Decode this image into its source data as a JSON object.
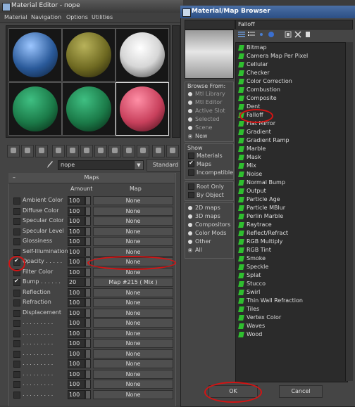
{
  "material_editor": {
    "title": "Material Editor - поре",
    "menu": [
      "Material",
      "Navigation",
      "Options",
      "Utilities"
    ],
    "slots": [
      {
        "color": "#4a7fc0"
      },
      {
        "color": "#8f8a32"
      },
      {
        "color": "#f2f2f2"
      },
      {
        "color": "#1f8a55"
      },
      {
        "color": "#1f8a55"
      },
      {
        "color": "#d64a6a"
      }
    ],
    "material_name": "поре",
    "material_type": "Standard",
    "maps_rollout": {
      "title": "Maps",
      "collapse_symbol": "–",
      "columns": {
        "amount": "Amount",
        "map": "Map"
      },
      "rows": [
        {
          "label": "Ambient Color",
          "amount": "100",
          "map": "None",
          "checked": false
        },
        {
          "label": "Diffuse Color",
          "amount": "100",
          "map": "None",
          "checked": false
        },
        {
          "label": "Specular Color",
          "amount": "100",
          "map": "None",
          "checked": false
        },
        {
          "label": "Specular Level",
          "amount": "100",
          "map": "None",
          "checked": false
        },
        {
          "label": "Glossiness",
          "amount": "100",
          "map": "None",
          "checked": false
        },
        {
          "label": "Self-Illumination",
          "amount": "100",
          "map": "None",
          "checked": false
        },
        {
          "label": "Opacity . . . . .",
          "amount": "100",
          "map": "None",
          "checked": true
        },
        {
          "label": "Filter Color",
          "amount": "100",
          "map": "None",
          "checked": false
        },
        {
          "label": "Bump . . . . . .",
          "amount": "20",
          "map": "Map #215  ( Mix )",
          "checked": true
        },
        {
          "label": "Reflection",
          "amount": "100",
          "map": "None",
          "checked": false
        },
        {
          "label": "Refraction",
          "amount": "100",
          "map": "None",
          "checked": false
        },
        {
          "label": "Displacement",
          "amount": "100",
          "map": "None",
          "checked": false
        },
        {
          "label": ". . . . . . . . .",
          "amount": "100",
          "map": "None",
          "checked": false
        },
        {
          "label": ". . . . . . . . .",
          "amount": "100",
          "map": "None",
          "checked": false
        },
        {
          "label": ". . . . . . . . .",
          "amount": "100",
          "map": "None",
          "checked": false
        },
        {
          "label": ". . . . . . . . .",
          "amount": "100",
          "map": "None",
          "checked": false
        },
        {
          "label": ". . . . . . . . .",
          "amount": "100",
          "map": "None",
          "checked": false
        },
        {
          "label": ". . . . . . . . .",
          "amount": "100",
          "map": "None",
          "checked": false
        },
        {
          "label": ". . . . . . . . .",
          "amount": "100",
          "map": "None",
          "checked": false
        },
        {
          "label": ". . . . . . . . .",
          "amount": "100",
          "map": "None",
          "checked": false
        }
      ]
    }
  },
  "browser": {
    "title": "Material/Map Browser",
    "filter_text": "Falloff",
    "browse_from": {
      "title": "Browse From:",
      "options": [
        "Mtl Library",
        "Mtl Editor",
        "Active Slot",
        "Selected",
        "Scene",
        "New"
      ],
      "selected": "New"
    },
    "show": {
      "title": "Show",
      "options": [
        {
          "label": "Materials",
          "checked": false
        },
        {
          "label": "Maps",
          "checked": true
        },
        {
          "label": "Incompatible",
          "checked": false
        }
      ]
    },
    "root": [
      {
        "label": "Root Only",
        "checked": false
      },
      {
        "label": "By Object",
        "checked": false
      }
    ],
    "map_types": {
      "options": [
        "2D maps",
        "3D maps",
        "Compositors",
        "Color Mods",
        "Other",
        "All"
      ],
      "selected": "All"
    },
    "items": [
      "Bitmap",
      "Camera Map Per Pixel",
      "Cellular",
      "Checker",
      "Color Correction",
      "Combustion",
      "Composite",
      "Dent",
      "Falloff",
      "Flat Mirror",
      "Gradient",
      "Gradient Ramp",
      "Marble",
      "Mask",
      "Mix",
      "Noise",
      "Normal Bump",
      "Output",
      "Particle Age",
      "Particle MBlur",
      "Perlin Marble",
      "Raytrace",
      "Reflect/Refract",
      "RGB Multiply",
      "RGB Tint",
      "Smoke",
      "Speckle",
      "Splat",
      "Stucco",
      "Swirl",
      "Thin Wall Refraction",
      "Tiles",
      "Vertex Color",
      "Waves",
      "Wood"
    ],
    "selected_item": "Falloff",
    "ok_label": "OK",
    "cancel_label": "Cancel"
  }
}
